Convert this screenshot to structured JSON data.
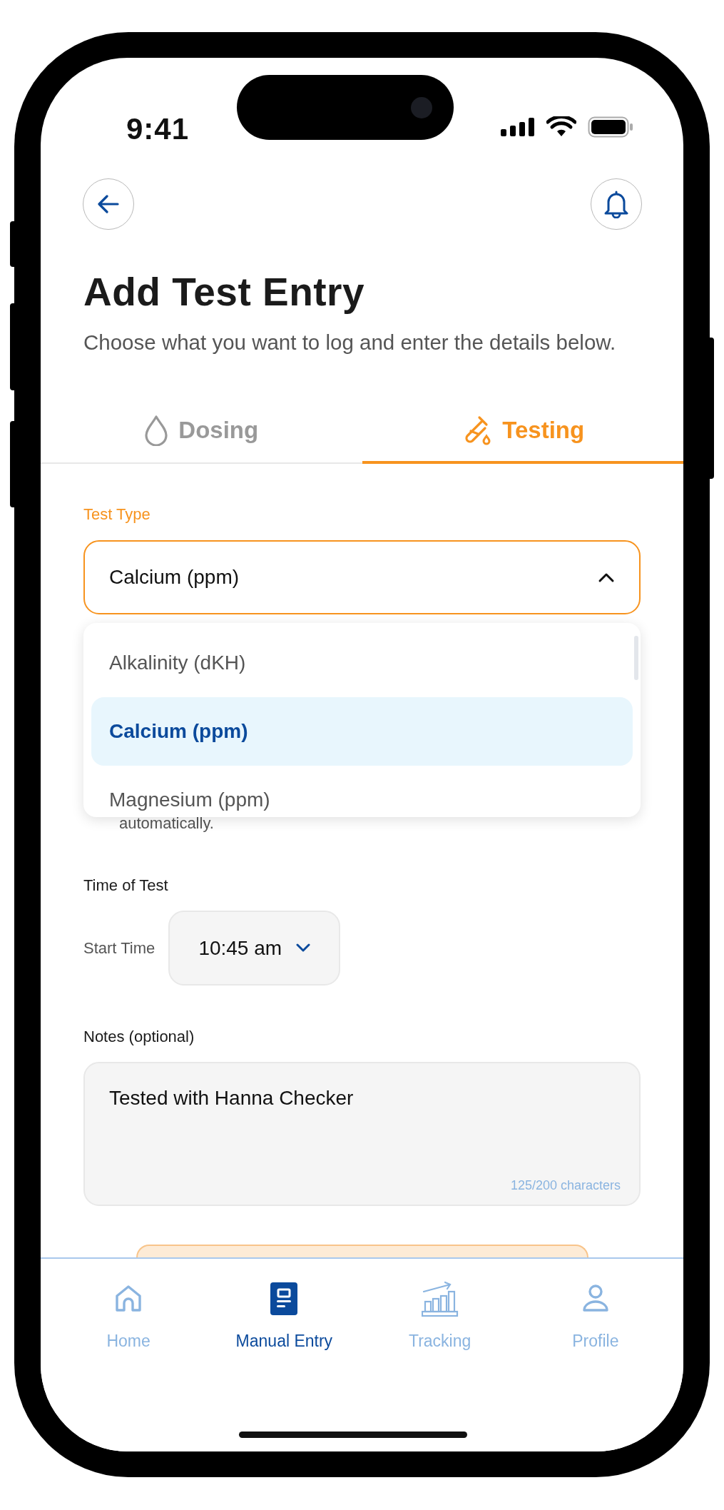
{
  "status_bar": {
    "time": "9:41"
  },
  "header": {
    "title": "Add Test Entry",
    "subtitle": "Choose what you want to log and enter the details below."
  },
  "tabs": [
    {
      "label": "Dosing",
      "kind": "drop",
      "selected": false
    },
    {
      "label": "Testing",
      "kind": "test-tube",
      "selected": true
    }
  ],
  "test_type": {
    "label": "Test Type",
    "value": "Calcium (ppm)",
    "expanded": true,
    "options": [
      {
        "label": "Alkalinity (dKH)",
        "selected": false
      },
      {
        "label": "Calcium (ppm)",
        "selected": true
      },
      {
        "label": "Magnesium (ppm)",
        "selected": false
      }
    ]
  },
  "hint": {
    "text": "automatically."
  },
  "time_of_test": {
    "label": "Time of Test",
    "start_label": "Start Time",
    "value": "10:45 am"
  },
  "notes": {
    "label": "Notes (optional)",
    "value": "Tested with Hanna Checker",
    "counter": "125/200 characters"
  },
  "nav": [
    {
      "label": "Home",
      "kind": "home",
      "selected": false
    },
    {
      "label": "Manual Entry",
      "kind": "entry",
      "selected": true
    },
    {
      "label": "Tracking",
      "kind": "chart",
      "selected": false
    },
    {
      "label": "Profile",
      "kind": "profile",
      "selected": false
    }
  ]
}
